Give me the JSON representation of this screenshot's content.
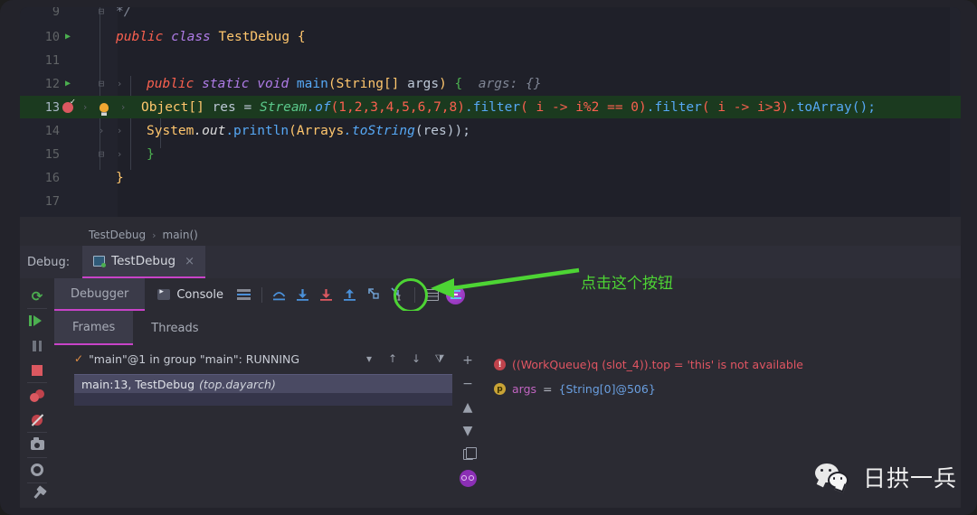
{
  "editor": {
    "lines": [
      {
        "num": "9",
        "text_html": "partial",
        "current": false
      },
      {
        "num": "10",
        "current": false
      },
      {
        "num": "11",
        "current": false
      },
      {
        "num": "12",
        "current": false
      },
      {
        "num": "13",
        "current": true
      },
      {
        "num": "14",
        "current": false
      },
      {
        "num": "15",
        "current": false
      },
      {
        "num": "16",
        "current": false
      },
      {
        "num": "17",
        "current": false
      }
    ],
    "line_numbers": [
      "9",
      "10",
      "11",
      "12",
      "13",
      "14",
      "15",
      "16",
      "17"
    ],
    "code": {
      "l10_kw_public": "public",
      "l10_kw_class": "class",
      "l10_name": "TestDebug",
      "l10_brace": "{",
      "l12_public": "public",
      "l12_static": "static",
      "l12_void": "void",
      "l12_main": "main",
      "l12_paren_open": "(",
      "l12_string": "String[]",
      "l12_args": "args",
      "l12_paren_close": ")",
      "l12_brace": "{",
      "l12_hint": "args: {}",
      "l13_type": "Object[]",
      "l13_res": "res",
      "l13_eq": "=",
      "l13_stream": "Stream",
      "l13_dot_of": ".of",
      "l13_nums": "(1,2,3,4,5,6,7,8)",
      "l13_filter1": ".filter",
      "l13_lambda1": "( i -> i%2 == 0)",
      "l13_filter2": ".filter",
      "l13_lambda2": "( i -> i>3)",
      "l13_toarray": ".toArray();",
      "l14_system": "System",
      "l14_out": ".out",
      "l14_println": ".println",
      "l14_arrays": "(Arrays",
      "l14_tostring": ".toString",
      "l14_res": "(res));",
      "l15_brace": "}",
      "l16_brace": "}"
    }
  },
  "breadcrumb": {
    "class": "TestDebug",
    "separator": "›",
    "method": "main()"
  },
  "debug_tabbar": {
    "label": "Debug:",
    "tab_title": "TestDebug",
    "close": "×"
  },
  "rail": {
    "items": [
      {
        "name": "rerun",
        "tooltip": "Rerun"
      },
      {
        "name": "resume-program",
        "tooltip": "Resume Program"
      },
      {
        "name": "pause-program",
        "tooltip": "Pause Program"
      },
      {
        "name": "stop",
        "tooltip": "Stop"
      },
      {
        "name": "view-breakpoints",
        "tooltip": "View Breakpoints"
      },
      {
        "name": "mute-breakpoints",
        "tooltip": "Mute Breakpoints"
      },
      {
        "name": "get-thread-dump",
        "tooltip": "Get Thread Dump"
      },
      {
        "name": "settings",
        "tooltip": "Settings"
      },
      {
        "name": "pin-tab",
        "tooltip": "Pin Tab"
      }
    ]
  },
  "toolbar": {
    "debugger_tab": "Debugger",
    "console_tab": "Console",
    "buttons": [
      "show-execution-point",
      "step-over",
      "step-into",
      "force-step-into",
      "step-out",
      "drop-frame",
      "run-to-cursor",
      "evaluate-expression",
      "trace-current-stream-chain"
    ]
  },
  "sub_tabs": {
    "frames": "Frames",
    "threads": "Threads"
  },
  "frames": {
    "thread_selector": "\"main\"@1 in group \"main\": RUNNING",
    "check": "✓",
    "row": {
      "location": "main:13, TestDebug",
      "package": "(top.dayarch)"
    }
  },
  "variables": [
    {
      "badge": "!",
      "badge_type": "error",
      "text": "((WorkQueue)q (slot_4)).top = 'this' is not available",
      "kind": "error"
    },
    {
      "badge": "p",
      "badge_type": "param",
      "name": "args",
      "eq": "=",
      "value": "{String[0]@506}",
      "kind": "param"
    }
  ],
  "vars_toolbar": {
    "add": "+",
    "remove": "−",
    "up": "▲",
    "down": "▼",
    "copy": "copy-icon",
    "watch": "watches-icon"
  },
  "annotation": {
    "tooltip": "Trace Current Stream Chain",
    "chinese_note": "点击这个按钮",
    "highlight_color": "#4dd434"
  },
  "watermark": {
    "text": "日拱一兵",
    "icon": "wechat-logo"
  },
  "colors": {
    "editor_bg": "#1f2029",
    "panel_bg": "#2b2b33",
    "current_line": "#1b3a1f",
    "accent_magenta": "#c843c8",
    "accent_green": "#4dd434",
    "breakpoint_red": "#db5860"
  }
}
